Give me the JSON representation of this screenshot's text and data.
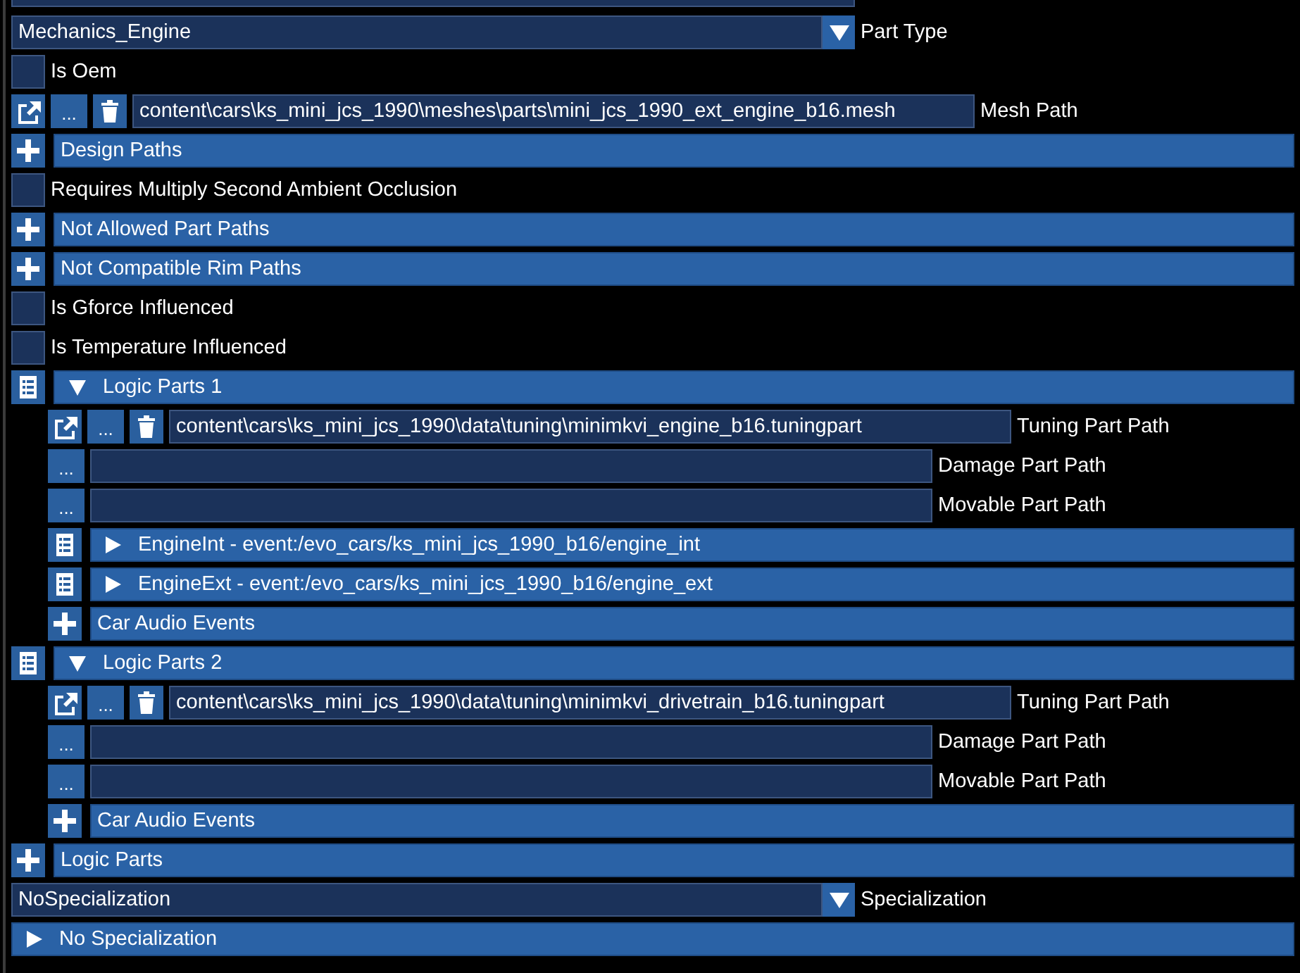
{
  "rows": [
    {
      "kind": "dropdown",
      "value": "Mechanics_Engine",
      "label": "Part Type"
    },
    {
      "kind": "checkbox",
      "caption": "Is Oem",
      "checked": false
    },
    {
      "kind": "path",
      "open": true,
      "browse": "...",
      "delete": true,
      "value": "content\\cars\\ks_mini_jcs_1990\\meshes\\parts\\mini_jcs_1990_ext_engine_b16.mesh",
      "label": "Mesh Path"
    },
    {
      "kind": "add",
      "title": "Design Paths"
    },
    {
      "kind": "checkbox",
      "caption": "Requires Multiply Second Ambient Occlusion",
      "checked": false
    },
    {
      "kind": "add",
      "title": "Not Allowed Part Paths"
    },
    {
      "kind": "add",
      "title": "Not Compatible Rim Paths"
    },
    {
      "kind": "checkbox",
      "caption": "Is Gforce Influenced",
      "checked": false
    },
    {
      "kind": "checkbox",
      "caption": "Is Temperature Influenced",
      "checked": false
    },
    {
      "kind": "group",
      "title": "Logic Parts 1",
      "expanded": true,
      "children": [
        {
          "kind": "path",
          "open": true,
          "browse": "...",
          "delete": true,
          "value": "content\\cars\\ks_mini_jcs_1990\\data\\tuning\\minimkvi_engine_b16.tuningpart",
          "label": "Tuning Part Path"
        },
        {
          "kind": "path",
          "open": false,
          "browse": "...",
          "delete": false,
          "label": "Damage Part Path"
        },
        {
          "kind": "path",
          "open": false,
          "browse": "...",
          "delete": false,
          "label": "Movable Part Path"
        },
        {
          "kind": "group",
          "title": "EngineInt - event:/evo_cars/ks_mini_jcs_1990_b16/engine_int",
          "expanded": false
        },
        {
          "kind": "group",
          "title": "EngineExt - event:/evo_cars/ks_mini_jcs_1990_b16/engine_ext",
          "expanded": false
        },
        {
          "kind": "add",
          "title": "Car Audio Events"
        }
      ]
    },
    {
      "kind": "group",
      "title": "Logic Parts 2",
      "expanded": true,
      "children": [
        {
          "kind": "path",
          "open": true,
          "browse": "...",
          "delete": true,
          "value": "content\\cars\\ks_mini_jcs_1990\\data\\tuning\\minimkvi_drivetrain_b16.tuningpart",
          "label": "Tuning Part Path"
        },
        {
          "kind": "path",
          "open": false,
          "browse": "...",
          "delete": false,
          "label": "Damage Part Path"
        },
        {
          "kind": "path",
          "open": false,
          "browse": "...",
          "delete": false,
          "label": "Movable Part Path"
        },
        {
          "kind": "add",
          "title": "Car Audio Events"
        }
      ]
    },
    {
      "kind": "add",
      "title": "Logic Parts"
    },
    {
      "kind": "dropdown",
      "value": "NoSpecialization",
      "label": "Specialization"
    },
    {
      "kind": "tree",
      "title": "No Specialization",
      "expanded": false
    }
  ]
}
